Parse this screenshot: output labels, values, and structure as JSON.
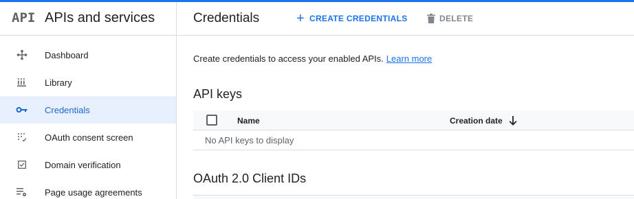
{
  "sidebar": {
    "logo_text": "API",
    "title": "APIs and services",
    "items": [
      {
        "label": "Dashboard",
        "icon": "dashboard-icon",
        "active": false
      },
      {
        "label": "Library",
        "icon": "library-icon",
        "active": false
      },
      {
        "label": "Credentials",
        "icon": "key-icon",
        "active": true
      },
      {
        "label": "OAuth consent screen",
        "icon": "oauth-consent-icon",
        "active": false
      },
      {
        "label": "Domain verification",
        "icon": "checkbox-verify-icon",
        "active": false
      },
      {
        "label": "Page usage agreements",
        "icon": "settings-list-icon",
        "active": false
      }
    ]
  },
  "header": {
    "title": "Credentials",
    "create_label": "CREATE CREDENTIALS",
    "delete_label": "DELETE"
  },
  "main": {
    "intro_text": "Create credentials to access your enabled APIs.",
    "learn_more": "Learn more",
    "api_keys": {
      "title": "API keys",
      "columns": [
        "Name",
        "Creation date"
      ],
      "sort_column": "Creation date",
      "sort_direction": "descending",
      "empty_text": "No API keys to display"
    },
    "oauth": {
      "title": "OAuth 2.0 Client IDs"
    }
  },
  "colors": {
    "accent": "#1a73e8",
    "active_bg": "#e8f0fe",
    "disabled": "#80868b"
  }
}
